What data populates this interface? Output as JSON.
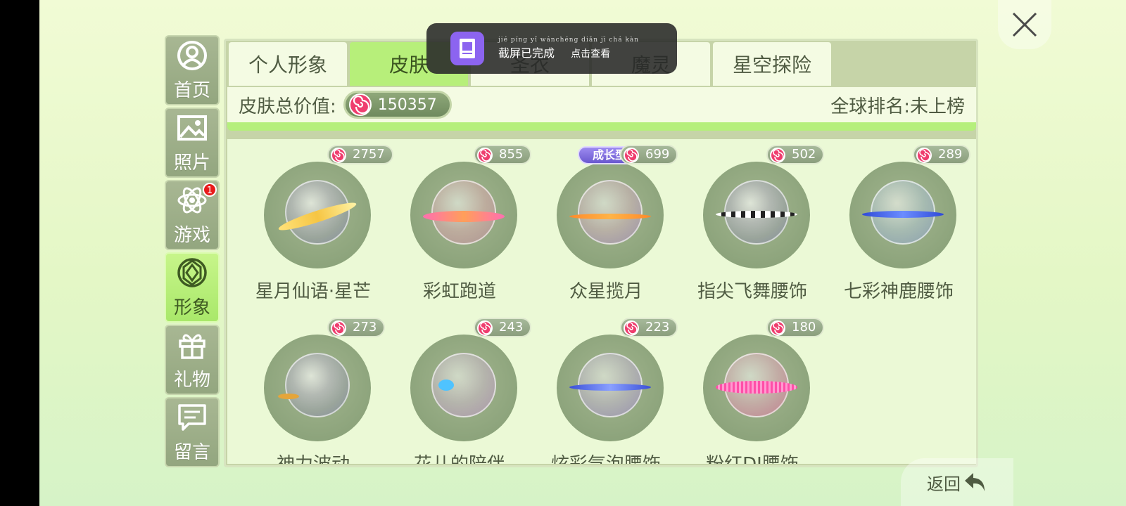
{
  "toast": {
    "pinyin": "jié píng yǐ wánchéng   diǎn jī chá kàn",
    "text_main": "截屏已完成",
    "text_action": "点击查看"
  },
  "sidebar": {
    "items": [
      {
        "label": "首页",
        "icon": "user-icon"
      },
      {
        "label": "照片",
        "icon": "photo-icon"
      },
      {
        "label": "游戏",
        "icon": "atom-icon",
        "badge": "1"
      },
      {
        "label": "形象",
        "icon": "diamond-icon",
        "active": true
      },
      {
        "label": "礼物",
        "icon": "gift-icon"
      },
      {
        "label": "留言",
        "icon": "message-icon"
      }
    ]
  },
  "tabs": [
    {
      "label": "个人形象"
    },
    {
      "label": "皮肤",
      "active": true
    },
    {
      "label": "圣衣"
    },
    {
      "label": "魔灵"
    },
    {
      "label": "星空探险"
    }
  ],
  "summary": {
    "value_label": "皮肤总价值:",
    "value": "150357",
    "rank": "全球排名:未上榜"
  },
  "items": [
    {
      "name": "星月仙语·星芒",
      "price": "2757"
    },
    {
      "name": "彩虹跑道",
      "price": "855"
    },
    {
      "name": "众星揽月",
      "price": "699",
      "tag": "成长型"
    },
    {
      "name": "指尖飞舞腰饰",
      "price": "502"
    },
    {
      "name": "七彩神鹿腰饰",
      "price": "289"
    },
    {
      "name": "神力波动",
      "price": "273"
    },
    {
      "name": "花儿的陪伴",
      "price": "243"
    },
    {
      "name": "炫彩气泡腰饰",
      "price": "223"
    },
    {
      "name": "粉红DJ腰饰",
      "price": "180"
    }
  ],
  "back": {
    "label": "返回"
  },
  "colors": {
    "accent_green": "#b7ef7a",
    "sidebar_bg": "#93a67f",
    "coin_red": "#e8386a"
  }
}
